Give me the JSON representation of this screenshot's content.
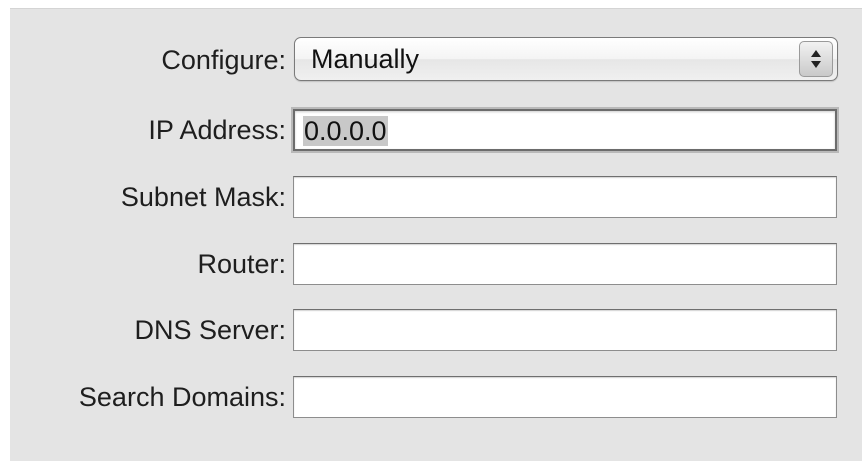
{
  "configure": {
    "label": "Configure:",
    "selected": "Manually"
  },
  "fields": {
    "ip_address": {
      "label": "IP Address:",
      "value": "0.0.0.0"
    },
    "subnet_mask": {
      "label": "Subnet Mask:",
      "value": ""
    },
    "router": {
      "label": "Router:",
      "value": ""
    },
    "dns_server": {
      "label": "DNS Server:",
      "value": ""
    },
    "search_domains": {
      "label": "Search Domains:",
      "value": ""
    }
  },
  "icons": {
    "popup_arrows": "up-down-chevron-icon"
  }
}
